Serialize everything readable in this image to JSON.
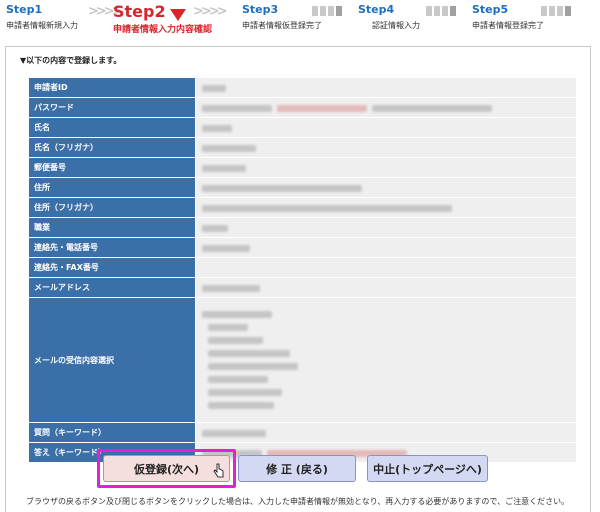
{
  "steps": [
    {
      "title": "Step1",
      "label": "申請者情報新規入力"
    },
    {
      "title": "Step2",
      "label": "申請者情報入力内容確認"
    },
    {
      "title": "Step3",
      "label": "申請者情報仮登録完了"
    },
    {
      "title": "Step4",
      "label": "認証情報入力"
    },
    {
      "title": "Step5",
      "label": "申請者情報登録完了"
    }
  ],
  "intro": "▼以下の内容で登録します。",
  "fields": [
    {
      "label": "申請者ID"
    },
    {
      "label": "パスワード"
    },
    {
      "label": "氏名"
    },
    {
      "label": "氏名（フリガナ）"
    },
    {
      "label": "郵便番号"
    },
    {
      "label": "住所"
    },
    {
      "label": "住所（フリガナ）"
    },
    {
      "label": "職業"
    },
    {
      "label": "連絡先・電話番号"
    },
    {
      "label": "連絡先・FAX番号"
    },
    {
      "label": "メールアドレス"
    },
    {
      "label": "メールの受信内容選択"
    },
    {
      "label": "質問（キーワード）"
    },
    {
      "label": "答え（キーワード）"
    }
  ],
  "buttons": {
    "register": "仮登録(次へ)",
    "fix": "修 正 (戻る)",
    "stop": "中止(トップページへ)"
  },
  "note": "ブラウザの戻るボタン及び閉じるボタンをクリックした場合は、入力した申請者情報が無効となり、再入力する必要がありますので、ご注意ください。",
  "colors": {
    "accent_red": "#d9252a",
    "step_blue": "#1e6fc0",
    "label_bg": "#3b6fa8",
    "highlight": "#e31fd9"
  }
}
